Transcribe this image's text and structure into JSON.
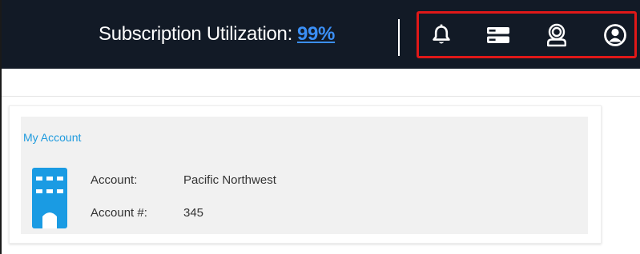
{
  "header": {
    "utilization_label": "Subscription Utilization:",
    "utilization_value": "99%",
    "icons": [
      "bell-icon",
      "server-icon",
      "support-agent-icon",
      "user-account-icon"
    ],
    "highlight_color": "#e01818",
    "background_color": "#121a26"
  },
  "account_card": {
    "title": "My Account",
    "icon": "building-icon",
    "fields": [
      {
        "label": "Account:",
        "value": "Pacific Northwest"
      },
      {
        "label": "Account #:",
        "value": "345"
      }
    ],
    "accent_color": "#1f9bde"
  }
}
